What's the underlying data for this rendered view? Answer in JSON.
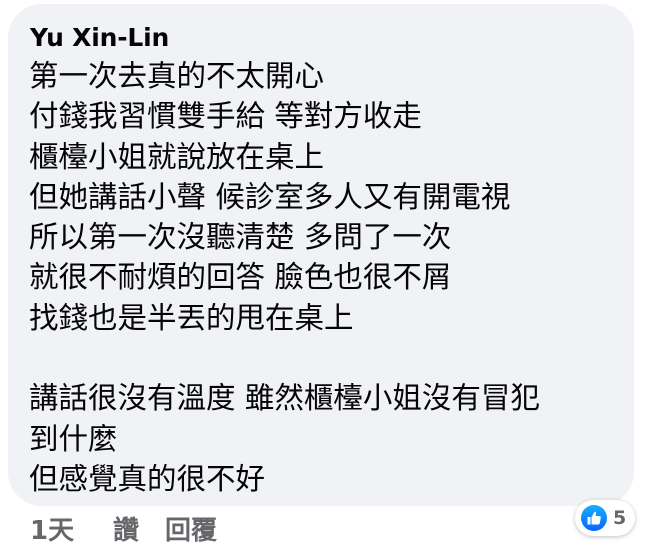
{
  "comment": {
    "author": "Yu Xin-Lin",
    "lines": [
      "第一次去真的不太開心",
      "付錢我習慣雙手給 等對方收走",
      "櫃檯小姐就說放在桌上",
      "但她講話小聲 候診室多人又有開電視",
      "所以第一次沒聽清楚 多問了一次",
      "就很不耐煩的回答 臉色也很不屑",
      "找錢也是半丟的甩在桌上",
      "",
      "講話很沒有溫度 雖然櫃檯小姐沒有冒犯",
      "到什麼",
      "但感覺真的很不好"
    ]
  },
  "actions": {
    "time": "1天",
    "like_label": "讚",
    "reply_label": "回覆"
  },
  "reactions": {
    "icon": "thumbs-up-icon",
    "count": "5",
    "color": "#0866ff"
  }
}
